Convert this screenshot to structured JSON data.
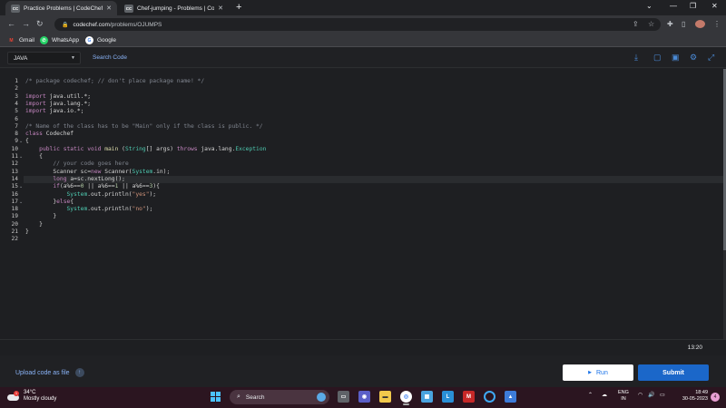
{
  "browser": {
    "tabs": [
      {
        "icon_text": "CC",
        "label": "Practice Problems | CodeChef",
        "active": true
      },
      {
        "icon_text": "CC",
        "label": "Chef-jumping - Problems | Code",
        "active": false
      }
    ],
    "new_tab_icon": "plus-icon",
    "address": {
      "host": "codechef.com",
      "path": "/problems/OJUMPS"
    },
    "bookmarks": [
      {
        "label": "Gmail",
        "icon": "gmail-icon",
        "icon_text": "M",
        "color": "#ea4335"
      },
      {
        "label": "WhatsApp",
        "icon": "whatsapp-icon",
        "icon_text": "✆",
        "color": "#25d366"
      },
      {
        "label": "Google",
        "icon": "google-icon",
        "icon_text": "G",
        "color": "#ffffff"
      }
    ]
  },
  "ide": {
    "language": "JAVA",
    "search_code": "Search Code",
    "cursor_position": "13:20",
    "current_line": 14,
    "code_lines": [
      [
        {
          "t": "/* package codechef; // don't place package name! */",
          "c": "cm"
        }
      ],
      [],
      [
        {
          "t": "import ",
          "c": "kw"
        },
        {
          "t": "java.util.*;",
          "c": ""
        }
      ],
      [
        {
          "t": "import ",
          "c": "kw"
        },
        {
          "t": "java.lang.*;",
          "c": ""
        }
      ],
      [
        {
          "t": "import ",
          "c": "kw"
        },
        {
          "t": "java.io.*;",
          "c": ""
        }
      ],
      [],
      [
        {
          "t": "/* Name of the class has to be \"Main\" only if the class is public. */",
          "c": "cm"
        }
      ],
      [
        {
          "t": "class ",
          "c": "kw"
        },
        {
          "t": "Codechef",
          "c": ""
        }
      ],
      [
        {
          "t": "{",
          "c": ""
        }
      ],
      [
        {
          "t": "    ",
          "c": ""
        },
        {
          "t": "public static void ",
          "c": "kw"
        },
        {
          "t": "main ",
          "c": "fn"
        },
        {
          "t": "(",
          "c": ""
        },
        {
          "t": "String",
          "c": "ty"
        },
        {
          "t": "[] args) ",
          "c": ""
        },
        {
          "t": "throws ",
          "c": "kw"
        },
        {
          "t": "java.lang.",
          "c": ""
        },
        {
          "t": "Exception",
          "c": "ty"
        }
      ],
      [
        {
          "t": "    {",
          "c": ""
        }
      ],
      [
        {
          "t": "        ",
          "c": ""
        },
        {
          "t": "// your code goes here",
          "c": "cm"
        }
      ],
      [
        {
          "t": "        Scanner sc=",
          "c": ""
        },
        {
          "t": "new ",
          "c": "kw"
        },
        {
          "t": "Scanner(",
          "c": ""
        },
        {
          "t": "System",
          "c": "ty"
        },
        {
          "t": ".in);",
          "c": ""
        }
      ],
      [
        {
          "t": "        ",
          "c": ""
        },
        {
          "t": "long ",
          "c": "kw"
        },
        {
          "t": "a=sc.nextLong();",
          "c": ""
        }
      ],
      [
        {
          "t": "        ",
          "c": ""
        },
        {
          "t": "if",
          "c": "kw"
        },
        {
          "t": "(a%6==",
          "c": ""
        },
        {
          "t": "0",
          "c": "nm"
        },
        {
          "t": " || a%6==",
          "c": ""
        },
        {
          "t": "1",
          "c": "nm"
        },
        {
          "t": " || a%6==",
          "c": ""
        },
        {
          "t": "3",
          "c": "nm"
        },
        {
          "t": "){",
          "c": ""
        }
      ],
      [
        {
          "t": "            ",
          "c": ""
        },
        {
          "t": "System",
          "c": "ty"
        },
        {
          "t": ".out.println(",
          "c": ""
        },
        {
          "t": "\"yes\"",
          "c": "st"
        },
        {
          "t": ");",
          "c": ""
        }
      ],
      [
        {
          "t": "        }",
          "c": ""
        },
        {
          "t": "else",
          "c": "kw"
        },
        {
          "t": "{",
          "c": ""
        }
      ],
      [
        {
          "t": "            ",
          "c": ""
        },
        {
          "t": "System",
          "c": "ty"
        },
        {
          "t": ".out.println(",
          "c": ""
        },
        {
          "t": "\"no\"",
          "c": "st"
        },
        {
          "t": ");",
          "c": ""
        }
      ],
      [
        {
          "t": "        }",
          "c": ""
        }
      ],
      [
        {
          "t": "    }",
          "c": ""
        }
      ],
      [
        {
          "t": "}",
          "c": ""
        }
      ],
      []
    ],
    "fold_lines": [
      9,
      11,
      15,
      17
    ],
    "toolbar_icons": [
      "download-icon",
      "feedback-icon",
      "save-icon",
      "settings-icon",
      "fullscreen-icon"
    ]
  },
  "footer": {
    "upload_label": "Upload code as file",
    "run_label": "Run",
    "submit_label": "Submit"
  },
  "taskbar": {
    "weather_temp": "34°C",
    "weather_desc": "Mostly cloudy",
    "weather_badge": "1",
    "search_label": "Search",
    "lang_line1": "ENG",
    "lang_line2": "IN",
    "time": "18:49",
    "date": "30-05-2023",
    "notification_badge": "4"
  },
  "colors": {
    "accent": "#1b67c9",
    "link": "#8ab4f8",
    "editor_bg": "#1e1f22"
  }
}
